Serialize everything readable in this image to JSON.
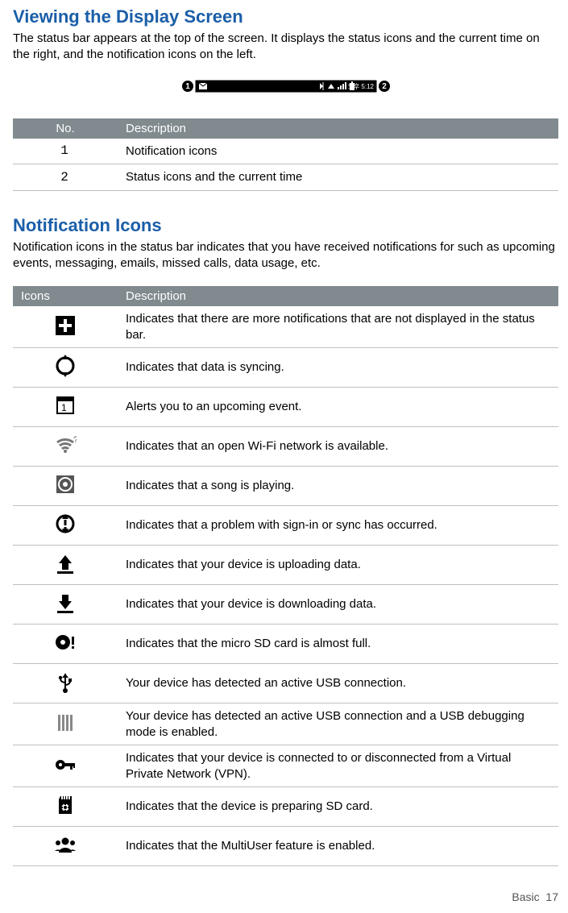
{
  "sections": {
    "viewing": {
      "title": "Viewing the Display Screen",
      "intro": "The status bar appears at the top of the screen. It displays the status icons and the current time on the right, and the notification icons on the   left."
    },
    "notif": {
      "title": "Notification Icons",
      "intro": "Notification icons in the status bar indicates that you have received notifications for such as upcoming events, messaging, emails, missed calls, data usage,  etc."
    }
  },
  "status_bar_time": "오후 5:12",
  "table1": {
    "headers": {
      "no": "No.",
      "desc": "Description"
    },
    "rows": [
      {
        "no": "1",
        "desc": "Notification icons"
      },
      {
        "no": "2",
        "desc": "Status icons and the current  time"
      }
    ]
  },
  "table2": {
    "headers": {
      "icons": "Icons",
      "desc": "Description"
    },
    "rows": [
      {
        "icon": "plus-icon",
        "desc": "Indicates that there are more notifications that are not displayed in the status bar."
      },
      {
        "icon": "sync-icon",
        "desc": "Indicates that data is  syncing."
      },
      {
        "icon": "calendar-icon",
        "desc": "Alerts you to an upcoming  event."
      },
      {
        "icon": "wifi-open-icon",
        "desc": "Indicates that an open Wi-Fi network is  available."
      },
      {
        "icon": "music-icon",
        "desc": "Indicates that a song is  playing."
      },
      {
        "icon": "sync-error-icon",
        "desc": "Indicates that a problem with sign-in or sync has   occurred."
      },
      {
        "icon": "upload-icon",
        "desc": "Indicates that your device is uploading  data."
      },
      {
        "icon": "download-icon",
        "desc": "Indicates that your device is downloading  data."
      },
      {
        "icon": "sd-full-icon",
        "desc": "Indicates that the micro SD card is almost  full."
      },
      {
        "icon": "usb-icon",
        "desc": "Your device has detected an active USB  connection."
      },
      {
        "icon": "usb-debug-icon",
        "desc": "Your device has detected an active USB connection and a USB debugging mode is enabled."
      },
      {
        "icon": "vpn-key-icon",
        "desc": "Indicates that your device is connected to or disconnected from a Virtual Private Network (VPN)."
      },
      {
        "icon": "sd-prep-icon",
        "desc": "Indicates that the device is preparing SD  card."
      },
      {
        "icon": "multiuser-icon",
        "desc": "Indicates that the MultiUser feature is  enabled."
      }
    ]
  },
  "footer": {
    "section": "Basic",
    "page": "17"
  }
}
